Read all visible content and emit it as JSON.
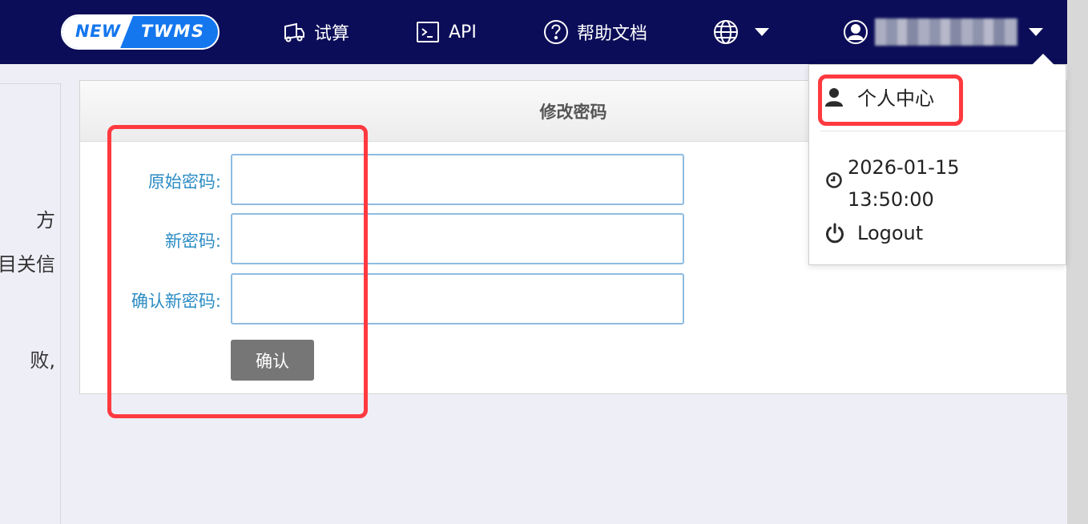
{
  "nav": {
    "logo_new": "NEW",
    "logo_twms": "TWMS",
    "items": [
      {
        "label": "试算",
        "icon": "truck-icon"
      },
      {
        "label": "API",
        "icon": "terminal-icon"
      },
      {
        "label": "帮助文档",
        "icon": "help-circle-icon"
      }
    ],
    "language_icon": "globe-icon",
    "user_icon": "user-circle-icon"
  },
  "left_fragments": [
    "方",
    "目关信",
    "败,"
  ],
  "form": {
    "title": "修改密码",
    "fields": [
      {
        "label": "原始密码:",
        "value": "",
        "placeholder": ""
      },
      {
        "label": "新密码:",
        "value": "",
        "placeholder": ""
      },
      {
        "label": "确认新密码:",
        "value": "",
        "placeholder": ""
      }
    ],
    "confirm_label": "确认"
  },
  "dropdown": {
    "personal_center": "个人中心",
    "datetime_date": "2026-01-15",
    "datetime_time": "13:50:00",
    "logout": "Logout"
  },
  "colors": {
    "nav_bg": "#0b0d58",
    "brand": "#1577ee",
    "label": "#2b8cc4",
    "highlight": "#ff3a3f",
    "button": "#767676"
  }
}
